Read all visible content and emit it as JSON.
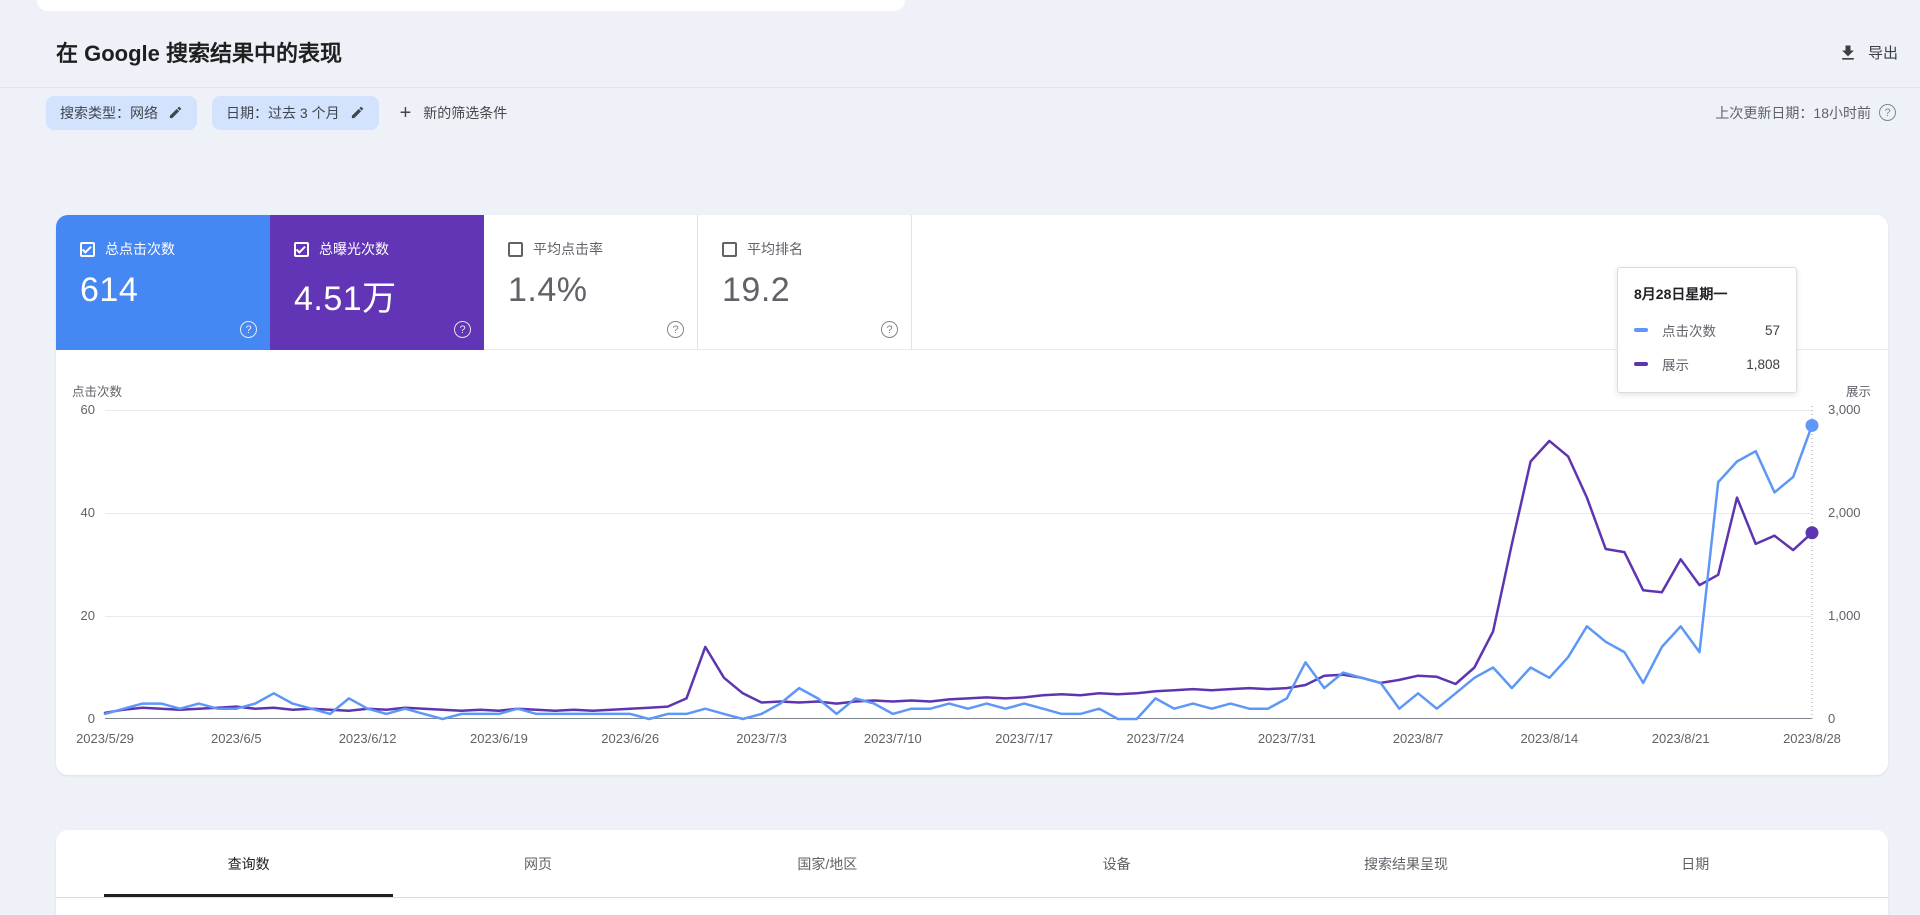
{
  "header": {
    "title": "在 Google 搜索结果中的表现",
    "export_label": "导出"
  },
  "filters": {
    "chips": [
      {
        "label": "搜索类型：网络"
      },
      {
        "label": "日期：过去 3 个月"
      }
    ],
    "add_filter_label": "新的筛选条件",
    "last_updated": "上次更新日期：18小时前"
  },
  "metrics": [
    {
      "label": "总点击次数",
      "value": "614",
      "checked": true,
      "bg": "#4587f3"
    },
    {
      "label": "总曝光次数",
      "value": "4.51万",
      "checked": true,
      "bg": "#6135b5"
    },
    {
      "label": "平均点击率",
      "value": "1.4%",
      "checked": false,
      "bg": ""
    },
    {
      "label": "平均排名",
      "value": "19.2",
      "checked": false,
      "bg": ""
    }
  ],
  "tooltip": {
    "title": "8月28日星期一",
    "rows": [
      {
        "label": "点击次数",
        "value": "57",
        "color": "#5e97f6"
      },
      {
        "label": "展示",
        "value": "1,808",
        "color": "#5e35b1"
      }
    ]
  },
  "chart_data": {
    "type": "line",
    "title": "在 Google 搜索结果中的表现 — 点击次数与展示",
    "x_start": "2023/5/29",
    "x_end": "2023/8/28",
    "x_tick_labels": [
      "2023/5/29",
      "2023/6/5",
      "2023/6/12",
      "2023/6/19",
      "2023/6/26",
      "2023/7/3",
      "2023/7/10",
      "2023/7/17",
      "2023/7/24",
      "2023/7/31",
      "2023/8/7",
      "2023/8/14",
      "2023/8/21",
      "2023/8/28"
    ],
    "y_left": {
      "label": "点击次数",
      "ticks": [
        "60",
        "40",
        "20",
        "0"
      ],
      "max": 60
    },
    "y_right": {
      "label": "展示",
      "ticks": [
        "3,000",
        "2,000",
        "1,000",
        "0"
      ],
      "max": 3000
    },
    "grid": true,
    "series": [
      {
        "name": "展示",
        "axis": "right",
        "color": "#5e35b1",
        "values": [
          60,
          90,
          110,
          100,
          90,
          100,
          110,
          120,
          100,
          110,
          90,
          100,
          90,
          80,
          100,
          90,
          110,
          100,
          90,
          80,
          90,
          80,
          100,
          90,
          80,
          90,
          80,
          90,
          100,
          110,
          120,
          200,
          700,
          400,
          250,
          160,
          170,
          160,
          170,
          150,
          170,
          180,
          170,
          180,
          170,
          190,
          200,
          210,
          200,
          210,
          230,
          240,
          230,
          250,
          240,
          250,
          270,
          280,
          290,
          280,
          290,
          300,
          290,
          300,
          330,
          420,
          430,
          400,
          350,
          380,
          420,
          410,
          340,
          500,
          850,
          1700,
          2500,
          2700,
          2550,
          2150,
          1650,
          1620,
          1250,
          1230,
          1550,
          1300,
          1400,
          2150,
          1700,
          1780,
          1640,
          1808
        ]
      },
      {
        "name": "点击次数",
        "axis": "left",
        "color": "#5e97f6",
        "values": [
          1,
          2,
          3,
          3,
          2,
          3,
          2,
          2,
          3,
          5,
          3,
          2,
          1,
          4,
          2,
          1,
          2,
          1,
          0,
          1,
          1,
          1,
          2,
          1,
          1,
          1,
          1,
          1,
          1,
          0,
          1,
          1,
          2,
          1,
          0,
          1,
          3,
          6,
          4,
          1,
          4,
          3,
          1,
          2,
          2,
          3,
          2,
          3,
          2,
          3,
          2,
          1,
          1,
          2,
          0,
          0,
          4,
          2,
          3,
          2,
          3,
          2,
          2,
          4,
          11,
          6,
          9,
          8,
          7,
          2,
          5,
          2,
          5,
          8,
          10,
          6,
          10,
          8,
          12,
          18,
          15,
          13,
          7,
          14,
          18,
          13,
          46,
          50,
          52,
          44,
          47,
          57
        ]
      }
    ],
    "highlight": {
      "date": "8月28日星期一",
      "clicks": 57,
      "impressions": 1808
    }
  },
  "tabs": [
    {
      "label": "查询数",
      "active": true
    },
    {
      "label": "网页",
      "active": false
    },
    {
      "label": "国家/地区",
      "active": false
    },
    {
      "label": "设备",
      "active": false
    },
    {
      "label": "搜索结果呈现",
      "active": false
    },
    {
      "label": "日期",
      "active": false
    }
  ]
}
